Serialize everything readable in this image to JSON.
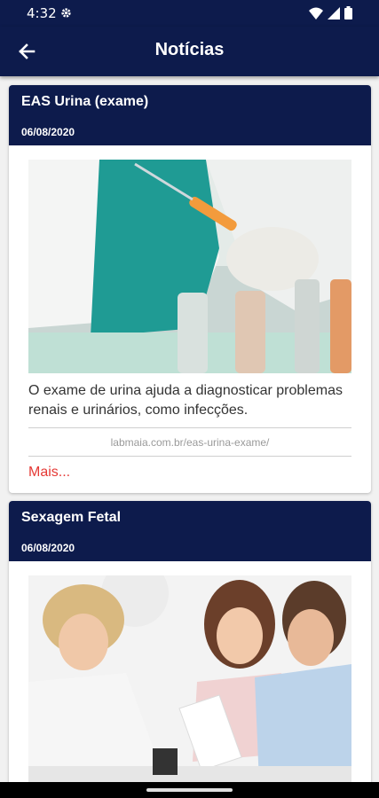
{
  "status_bar": {
    "time": "4:32",
    "icons": [
      "gear-icon",
      "wifi-icon",
      "signal-icon",
      "battery-icon"
    ]
  },
  "app_bar": {
    "title": "Notícias",
    "back_icon": "arrow-left-icon"
  },
  "news": [
    {
      "title": "EAS Urina (exame)",
      "date": "06/08/2020",
      "description": "O exame de urina ajuda a diagnosticar problemas renais e urinários, como infecções.",
      "source": "labmaia.com.br/eas-urina-exame/",
      "more_label": "Mais..."
    },
    {
      "title": "Sexagem Fetal",
      "date": "06/08/2020"
    }
  ],
  "colors": {
    "primary": "#0d1b4c",
    "link": "#e53935",
    "background": "#f1f1f1"
  }
}
